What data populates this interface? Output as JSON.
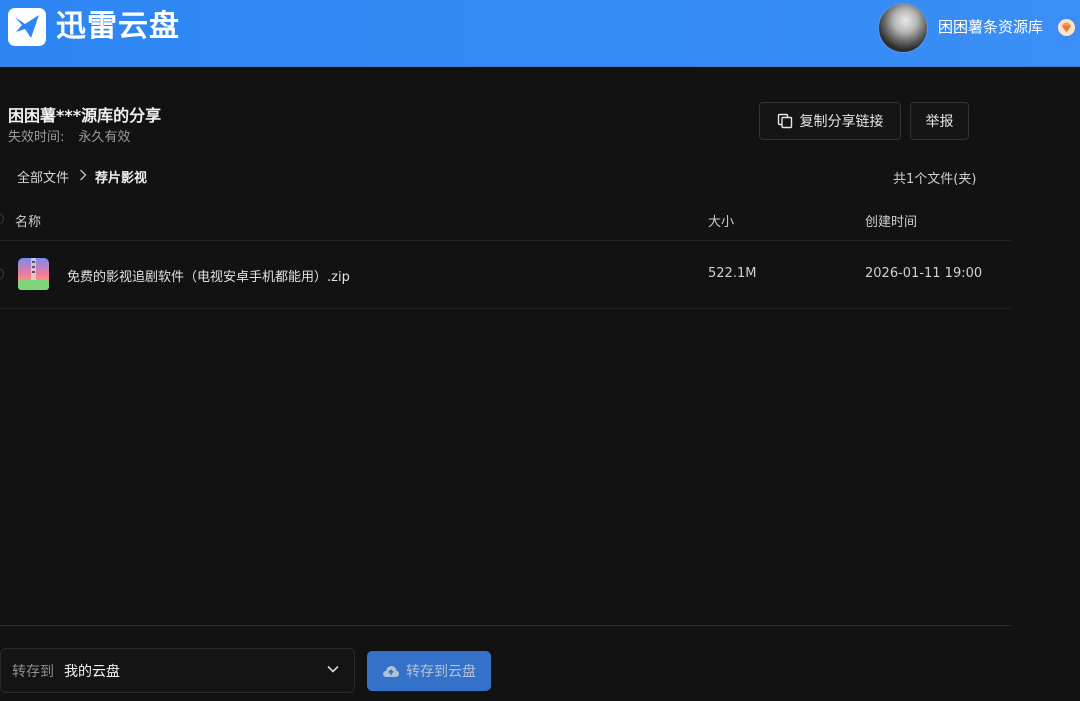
{
  "header": {
    "brand": "迅雷云盘",
    "username": "困困薯条资源库",
    "logo_icon": "thunder-bird-icon",
    "vip_icon": "diamond-icon"
  },
  "share": {
    "title": "困困薯***源库的分享",
    "expire_label": "失效时间:",
    "expire_value": "永久有效",
    "copy_link_label": "复制分享链接",
    "report_label": "举报"
  },
  "breadcrumb": {
    "root": "全部文件",
    "current": "荐片影视"
  },
  "file_count": "共1个文件(夹)",
  "table": {
    "columns": {
      "name": "名称",
      "size": "大小",
      "created": "创建时间"
    },
    "rows": [
      {
        "name": "免费的影视追剧软件（电视安卓手机都能用）.zip",
        "size": "522.1M",
        "created": "2026-01-11 19:00",
        "icon": "zip-archive-icon"
      }
    ]
  },
  "footer": {
    "save_to_label": "转存到",
    "save_to_value": "我的云盘",
    "save_button": "转存到云盘"
  },
  "colors": {
    "accent": "#2d86f4",
    "background": "#121212",
    "button": "#3a82e8"
  }
}
